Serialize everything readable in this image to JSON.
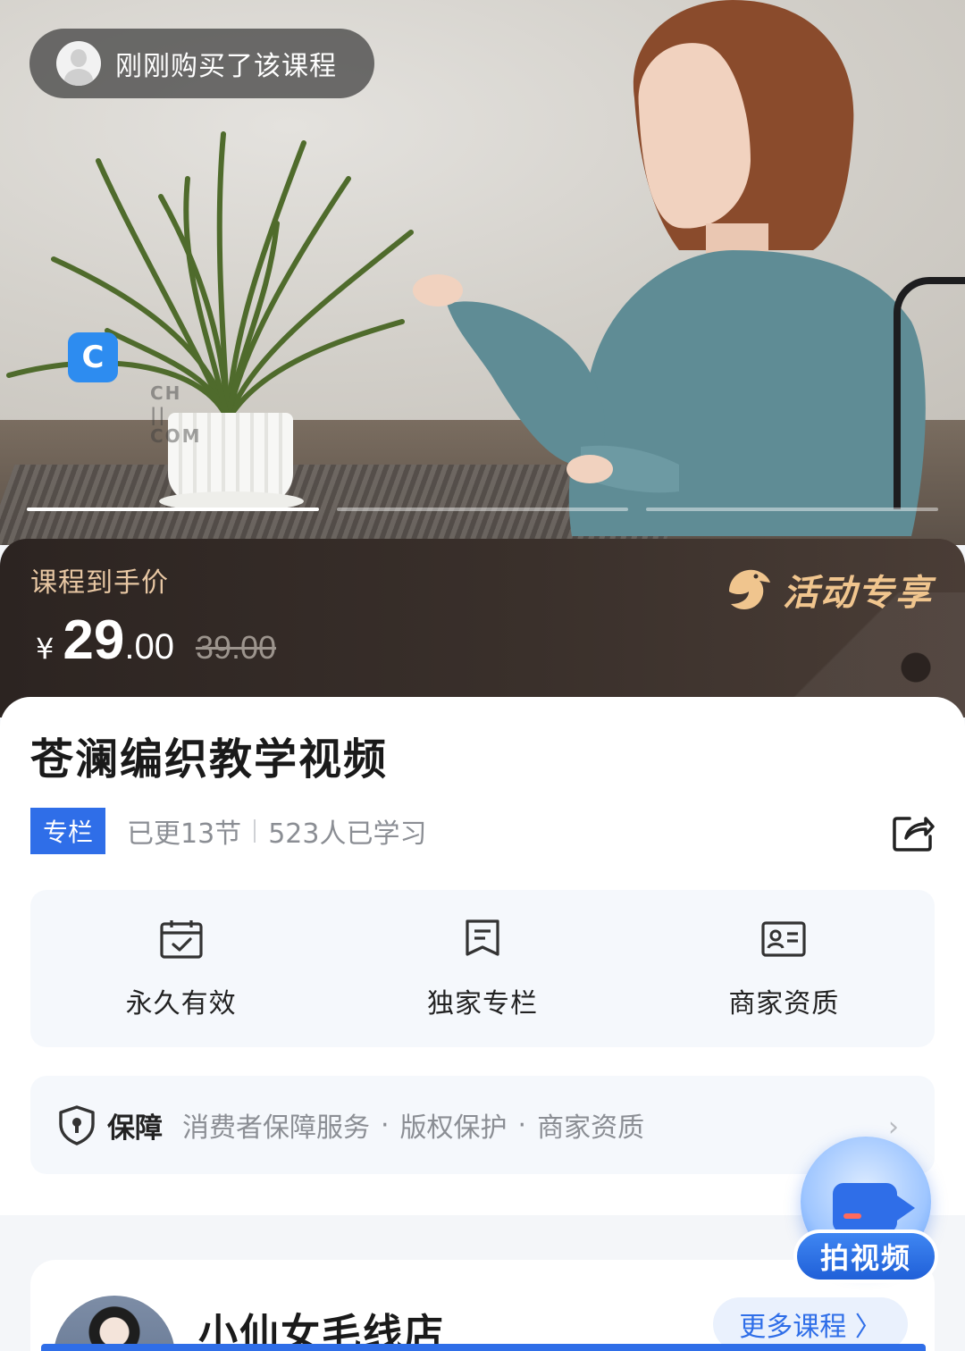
{
  "hero": {
    "toast_text": "刚刚购买了该课程",
    "watermark_cn": "",
    "watermark_en": "CH    ||    COM",
    "slides": [
      true,
      false,
      false
    ]
  },
  "price": {
    "label": "课程到手价",
    "currency": "¥",
    "integer": "29",
    "decimal": ".00",
    "original": "39.00",
    "promo": "活动专享"
  },
  "course": {
    "title": "苍澜编织教学视频",
    "tag": "专栏",
    "updated": "已更13节",
    "learners": "523人已学习"
  },
  "features": [
    {
      "label": "永久有效",
      "icon": "calendar-check-icon"
    },
    {
      "label": "独家专栏",
      "icon": "bookmark-doc-icon"
    },
    {
      "label": "商家资质",
      "icon": "id-card-icon"
    }
  ],
  "guarantee": {
    "title": "保障",
    "items": [
      "消费者保障服务",
      "版权保护",
      "商家资质"
    ],
    "separator": "·"
  },
  "shop": {
    "name": "小仙女毛线店",
    "more": "更多课程 〉"
  },
  "fab": {
    "label": "拍视频"
  },
  "colors": {
    "accent": "#2f6ee8",
    "price_label": "#e8c7a3",
    "promo": "#f0c58e"
  }
}
